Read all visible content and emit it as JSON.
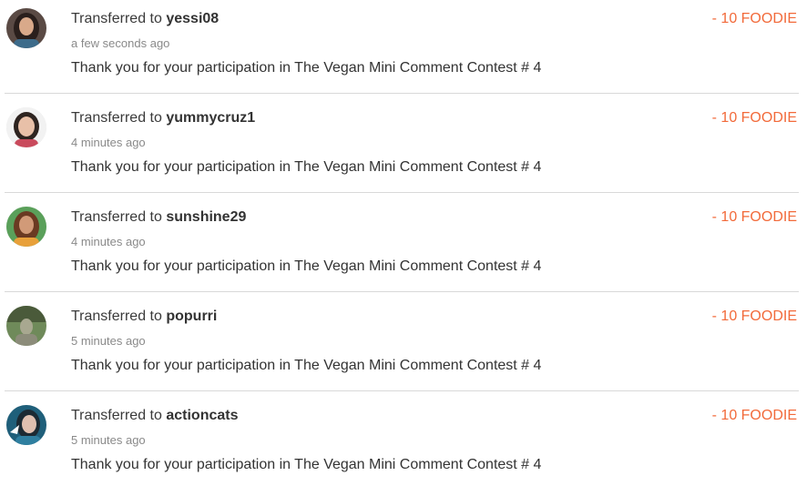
{
  "transfers": [
    {
      "prefix": "Transferred to",
      "username": "yessi08",
      "time": "a few seconds ago",
      "memo": "Thank you for your participation in The Vegan Mini Comment Contest # 4",
      "amount": "- 10 FOODIE",
      "avatar_icon": "avatar-yessi08-icon",
      "colors": {
        "bg": "#5a4a44",
        "hair": "#2a1f1c",
        "skin": "#d9a98a",
        "shirt": "#3d6b8a"
      }
    },
    {
      "prefix": "Transferred to",
      "username": "yummycruz1",
      "time": "4 minutes ago",
      "memo": "Thank you for your participation in The Vegan Mini Comment Contest # 4",
      "amount": "- 10 FOODIE",
      "avatar_icon": "avatar-yummycruz1-icon",
      "colors": {
        "bg": "#f2f2f2",
        "hair": "#2e2420",
        "skin": "#e8c0a8",
        "shirt": "#c94a5c"
      }
    },
    {
      "prefix": "Transferred to",
      "username": "sunshine29",
      "time": "4 minutes ago",
      "memo": "Thank you for your participation in The Vegan Mini Comment Contest # 4",
      "amount": "- 10 FOODIE",
      "avatar_icon": "avatar-sunshine29-icon",
      "colors": {
        "bg": "#5aa05a",
        "hair": "#6a3a22",
        "skin": "#d19a78",
        "shirt": "#e8a03a"
      }
    },
    {
      "prefix": "Transferred to",
      "username": "popurri",
      "time": "5 minutes ago",
      "memo": "Thank you for your participation in The Vegan Mini Comment Contest # 4",
      "amount": "- 10 FOODIE",
      "avatar_icon": "avatar-popurri-icon",
      "colors": {
        "bg": "#6f8a5a",
        "hair": "#4a5a3a",
        "skin": "#a8a890",
        "shirt": "#8c8c7a"
      }
    },
    {
      "prefix": "Transferred to",
      "username": "actioncats",
      "time": "5 minutes ago",
      "memo": "Thank you for your participation in The Vegan Mini Comment Contest # 4",
      "amount": "- 10 FOODIE",
      "avatar_icon": "avatar-actioncats-icon",
      "colors": {
        "bg": "#1f5f7a",
        "hair": "#1c2a33",
        "skin": "#e0c0b0",
        "shirt": "#2f7fa0"
      }
    }
  ],
  "colors": {
    "amount": "#f26a3a",
    "divider": "#d9d9d9"
  }
}
